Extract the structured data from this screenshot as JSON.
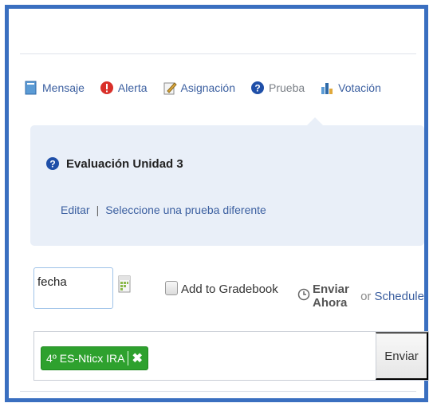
{
  "tabs": [
    {
      "label": "Mensaje",
      "icon": "message-icon"
    },
    {
      "label": "Alerta",
      "icon": "alert-icon"
    },
    {
      "label": "Asignación",
      "icon": "assignment-icon"
    },
    {
      "label": "Prueba",
      "icon": "quiz-icon",
      "active": true
    },
    {
      "label": "Votación",
      "icon": "poll-icon"
    }
  ],
  "quiz": {
    "title": "Evaluación Unidad 3",
    "edit_link": "Editar",
    "separator": "|",
    "change_link": "Seleccione una prueba diferente"
  },
  "options": {
    "date_value": "fecha",
    "gradebook_label": "Add to Gradebook",
    "gradebook_checked": false,
    "send_now_label": "Enviar Ahora",
    "or_text": "or",
    "schedule_label": "Schedule"
  },
  "recipients": {
    "tags": [
      {
        "label": "4º ES-Nticx IRA",
        "remove_icon": "close-icon"
      }
    ],
    "send_button": "Enviar"
  },
  "colors": {
    "frame": "#3a6fc0",
    "link": "#3b5fa0",
    "panel_bg": "#e9eff8",
    "tag_bg": "#2ea12e"
  }
}
